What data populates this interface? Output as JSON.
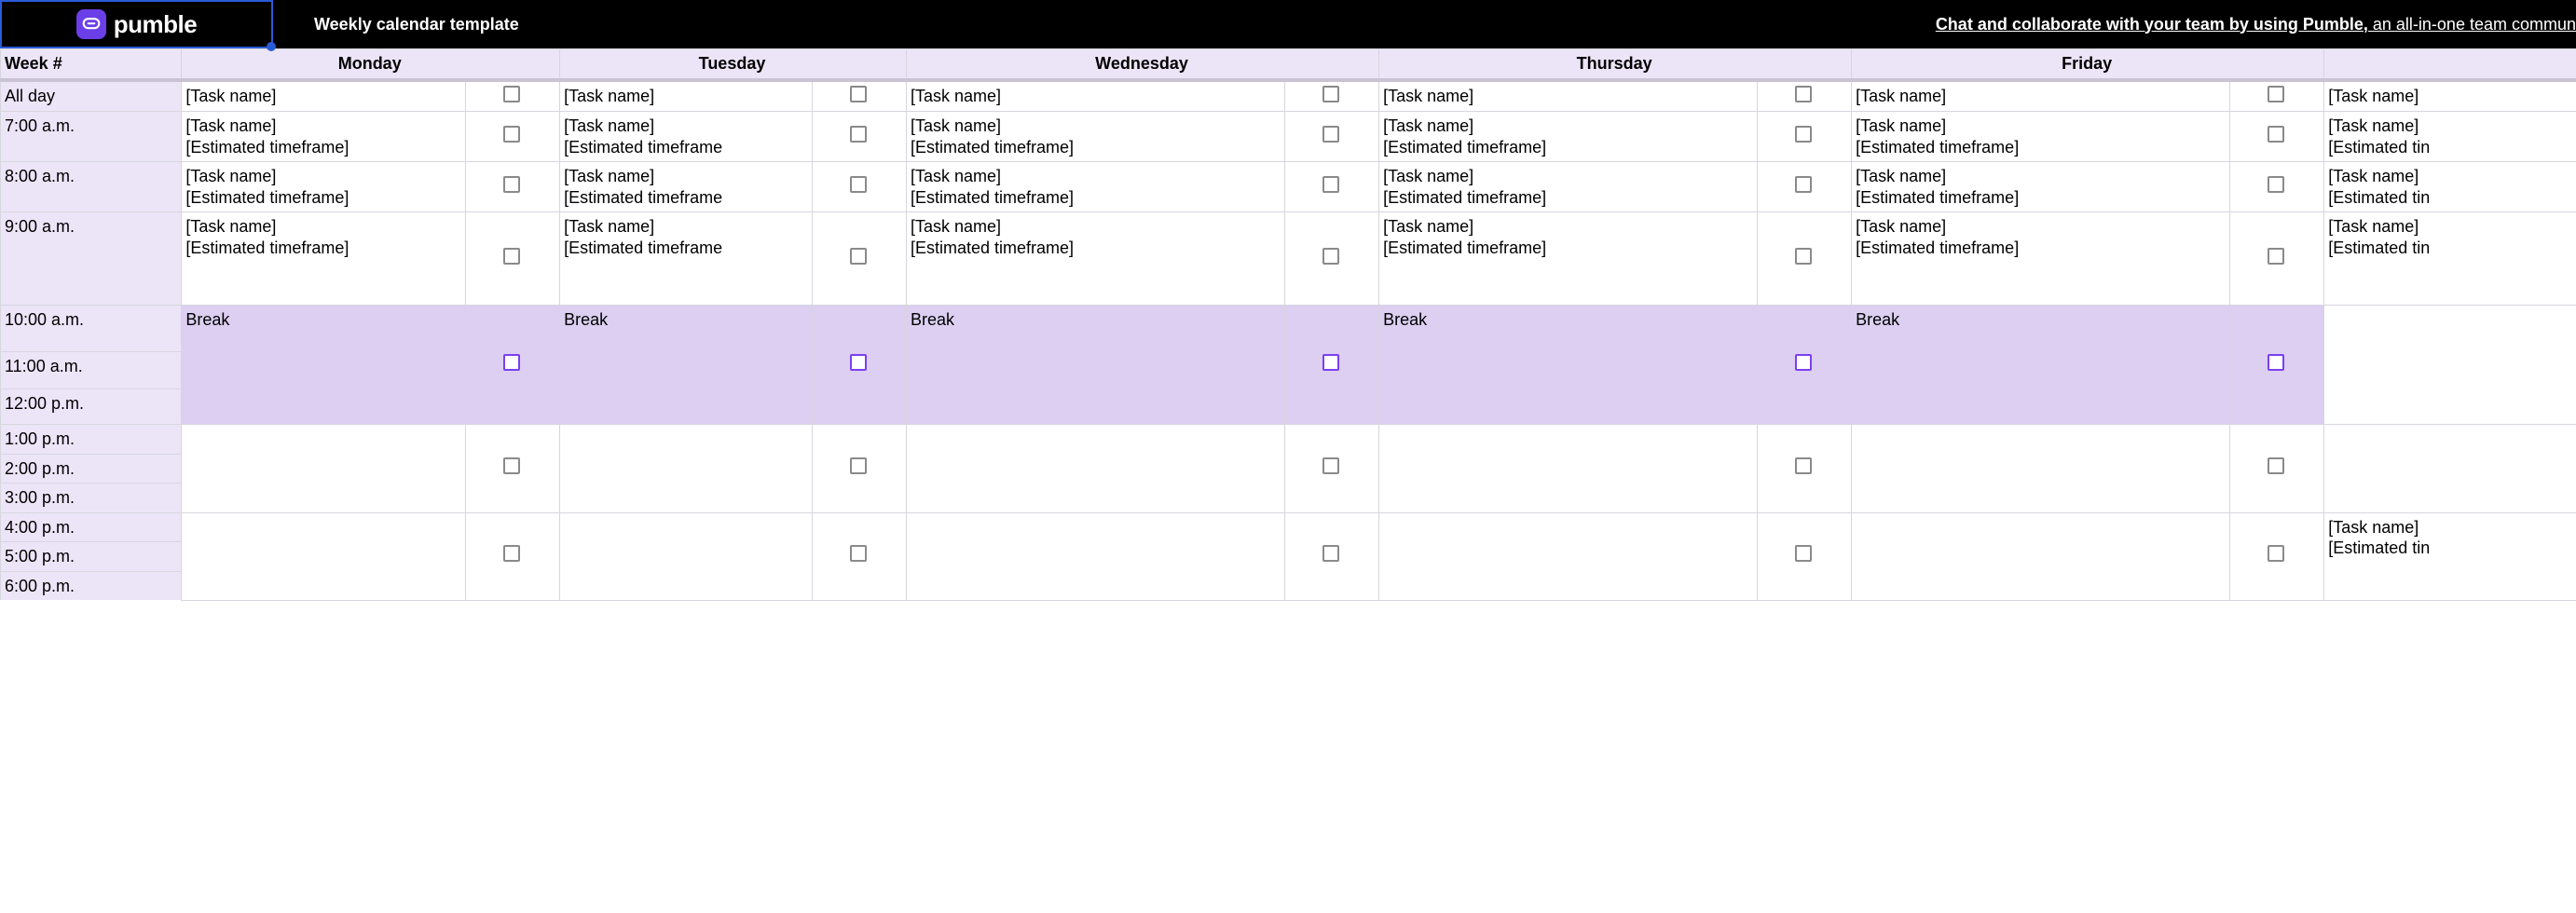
{
  "header": {
    "brand": "pumble",
    "title": "Weekly calendar template",
    "promo_bold": "Chat and collaborate with your team by using Pumble,",
    "promo_rest": " an all-in-one team commun"
  },
  "columns": {
    "week": "Week #",
    "days": [
      "Monday",
      "Tuesday",
      "Wednesday",
      "Thursday",
      "Friday",
      ""
    ]
  },
  "times": {
    "allday": "All day",
    "t7": "7:00 a.m.",
    "t8": "8:00 a.m.",
    "t9": "9:00 a.m.",
    "t10": "10:00 a.m.",
    "t11": "11:00 a.m.",
    "t12": "12:00 p.m.",
    "t13": "1:00 p.m.",
    "t14": "2:00 p.m.",
    "t15": "3:00 p.m.",
    "t16": "4:00 p.m.",
    "t17": "5:00 p.m.",
    "t18": "6:00 p.m."
  },
  "placeholders": {
    "task": "[Task name]",
    "task_tf": "[Task name]\n[Estimated timeframe]",
    "task_tf_cut": "[Task name]\n[Estimated timeframe",
    "task_tf_cut2": "[Task name]\n[Estimated tim",
    "task_tf_cut3": "[Task name]\n[Estimated tin",
    "break": "Break"
  }
}
